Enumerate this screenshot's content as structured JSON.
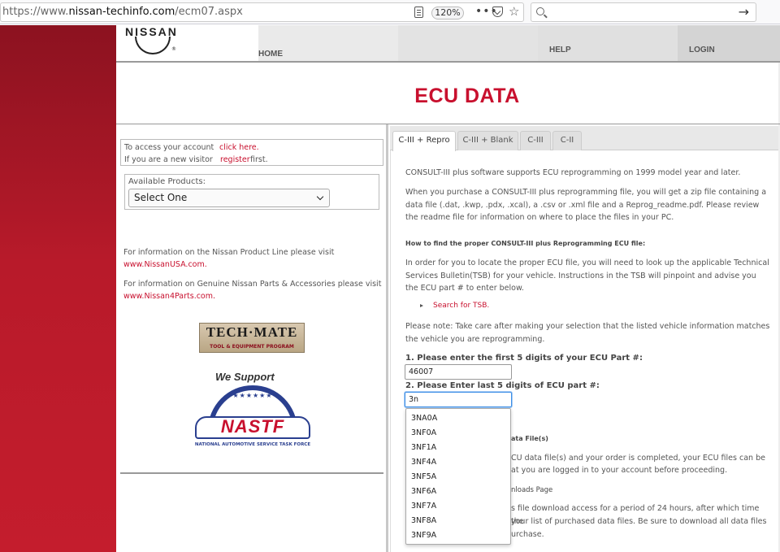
{
  "browser": {
    "url_prefix": "https://www.",
    "url_domain": "nissan-techinfo.com",
    "url_path": "/ecm07.aspx",
    "zoom": "120%"
  },
  "header": {
    "logo_text": "NISSAN",
    "logo_reg": "®",
    "nav": [
      "HOME",
      "",
      "HELP",
      "LOGIN"
    ]
  },
  "page": {
    "title": "ECU DATA"
  },
  "left": {
    "account_l1": "To access your account",
    "account_link1": "click here.",
    "account_l2": "If you are a new visitor",
    "account_link2": "register",
    "account_first": "first.",
    "products_label": "Available Products:",
    "products_value": "Select One",
    "info1": "For information on the Nissan Product Line please visit",
    "info1_link": "www.NissanUSA.com.",
    "info2": "For information on Genuine Nissan Parts & Accessories please visit",
    "info2_link": "www.Nissan4Parts.com.",
    "techmate_title": "TECH·MATE",
    "techmate_sub": "TOOL & EQUIPMENT PROGRAM",
    "we_support": "We Support",
    "nastf_word": "NASTF",
    "nastf_sub": "NATIONAL AUTOMOTIVE SERVICE TASK FORCE"
  },
  "tabs": [
    "C-III + Repro",
    "C-III + Blank",
    "C-III",
    "C-II"
  ],
  "content": {
    "p1": "CONSULT-III plus software supports ECU reprogramming on 1999 model year and later.",
    "p2": "When you purchase a CONSULT-III plus reprogramming file, you will get a zip file containing a data file (.dat, .kwp, .pdx, .xcal), a .csv or .xml file and a Reprog_readme.pdf. Please review the readme file for information on where to place the files in your PC.",
    "h1": "How to find the proper CONSULT-III plus Reprogramming ECU file:",
    "p3": "In order for you to locate the proper ECU file, you will need to look up the applicable Technical Services Bulletin(TSB) for your vehicle. Instructions in the TSB will pinpoint and advise you the ECU part # to enter below.",
    "tsb_link": "Search for TSB.",
    "p4": "Please note: Take care after making your selection that the listed vehicle information matches the vehicle you are reprogramming.",
    "label1": "1. Please enter the first 5 digits of your ECU Part #:",
    "input1": "46007",
    "label2": "2. Please Enter last 5 digits of ECU part #:",
    "input2": "3n",
    "hidden_h2": "ata File(s)",
    "hidden_p5a": "CU data file(s) and your order is completed, your ECU files can be",
    "hidden_p5b": "at you are logged in to your account before proceeding.",
    "hidden_h3": "nloads Page",
    "hidden_p6a": "s file download access for a period of 24 hours, after which time the",
    "hidden_p6b": "your list of purchased data files. Be sure to download all data files",
    "hidden_p6c": "urchase."
  },
  "suggestions": [
    "3NA0A",
    "3NF0A",
    "3NF1A",
    "3NF4A",
    "3NF5A",
    "3NF6A",
    "3NF7A",
    "3NF8A",
    "3NF9A"
  ],
  "colors": {
    "brand_red": "#c8102e",
    "band_red": "#b81a2a"
  }
}
